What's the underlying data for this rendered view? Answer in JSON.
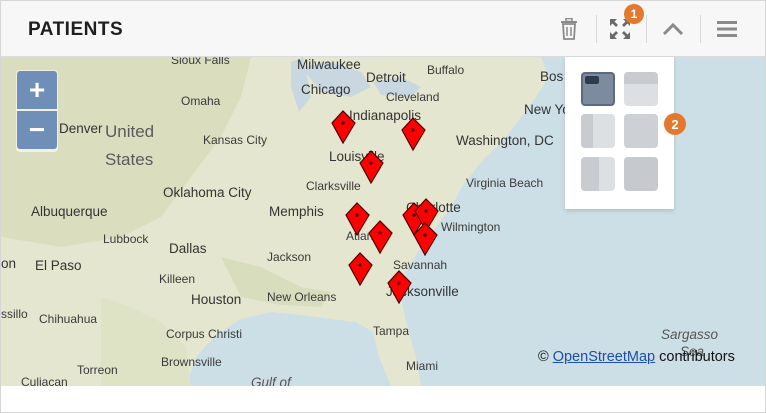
{
  "panel": {
    "title": "PATIENTS"
  },
  "toolbar": {
    "icons": [
      "trash-icon",
      "expand-icon",
      "chevron-up-icon",
      "menu-icon"
    ],
    "badges": {
      "expand": "1",
      "layout": "2"
    }
  },
  "map": {
    "zoom_in_label": "+",
    "zoom_out_label": "−",
    "attribution_prefix": "©",
    "attribution_link": "OpenStreetMap",
    "attribution_suffix": "contributors",
    "labels": [
      {
        "text": "Sioux Falls"
      },
      {
        "text": "Milwaukee"
      },
      {
        "text": "Detroit"
      },
      {
        "text": "Buffalo"
      },
      {
        "text": "Bos"
      },
      {
        "text": "Chicago"
      },
      {
        "text": "Cleveland"
      },
      {
        "text": "Omaha"
      },
      {
        "text": "Indianapolis"
      },
      {
        "text": "New York"
      },
      {
        "text": "Denver"
      },
      {
        "text": "United"
      },
      {
        "text": "States"
      },
      {
        "text": "Kansas City"
      },
      {
        "text": "Washington, DC"
      },
      {
        "text": "Louisville"
      },
      {
        "text": "Clarksville"
      },
      {
        "text": "Oklahoma City"
      },
      {
        "text": "Virginia Beach"
      },
      {
        "text": "Albuquerque"
      },
      {
        "text": "Memphis"
      },
      {
        "text": "Charlotte"
      },
      {
        "text": "Lubbock"
      },
      {
        "text": "Atlanta"
      },
      {
        "text": "Wilmington"
      },
      {
        "text": "Dallas"
      },
      {
        "text": "El Paso"
      },
      {
        "text": "Jackson"
      },
      {
        "text": "Savannah"
      },
      {
        "text": "Killeen"
      },
      {
        "text": "Jacksonville"
      },
      {
        "text": "Houston"
      },
      {
        "text": "New Orleans"
      },
      {
        "text": "Chihuahua"
      },
      {
        "text": "Corpus Christi"
      },
      {
        "text": "Tampa"
      },
      {
        "text": "Brownsville"
      },
      {
        "text": "Torreon"
      },
      {
        "text": "Culiacan"
      },
      {
        "text": "Miami"
      },
      {
        "text": "Gulf of"
      },
      {
        "text": "Sargasso"
      },
      {
        "text": "Sea"
      },
      {
        "text": "ssillo"
      },
      {
        "text": "on"
      }
    ],
    "markers_count": 12
  },
  "colors": {
    "accent": "#e2792e",
    "marker": "#ff0000",
    "zoom": "#6f8fb8",
    "link": "#1d4ea8"
  }
}
